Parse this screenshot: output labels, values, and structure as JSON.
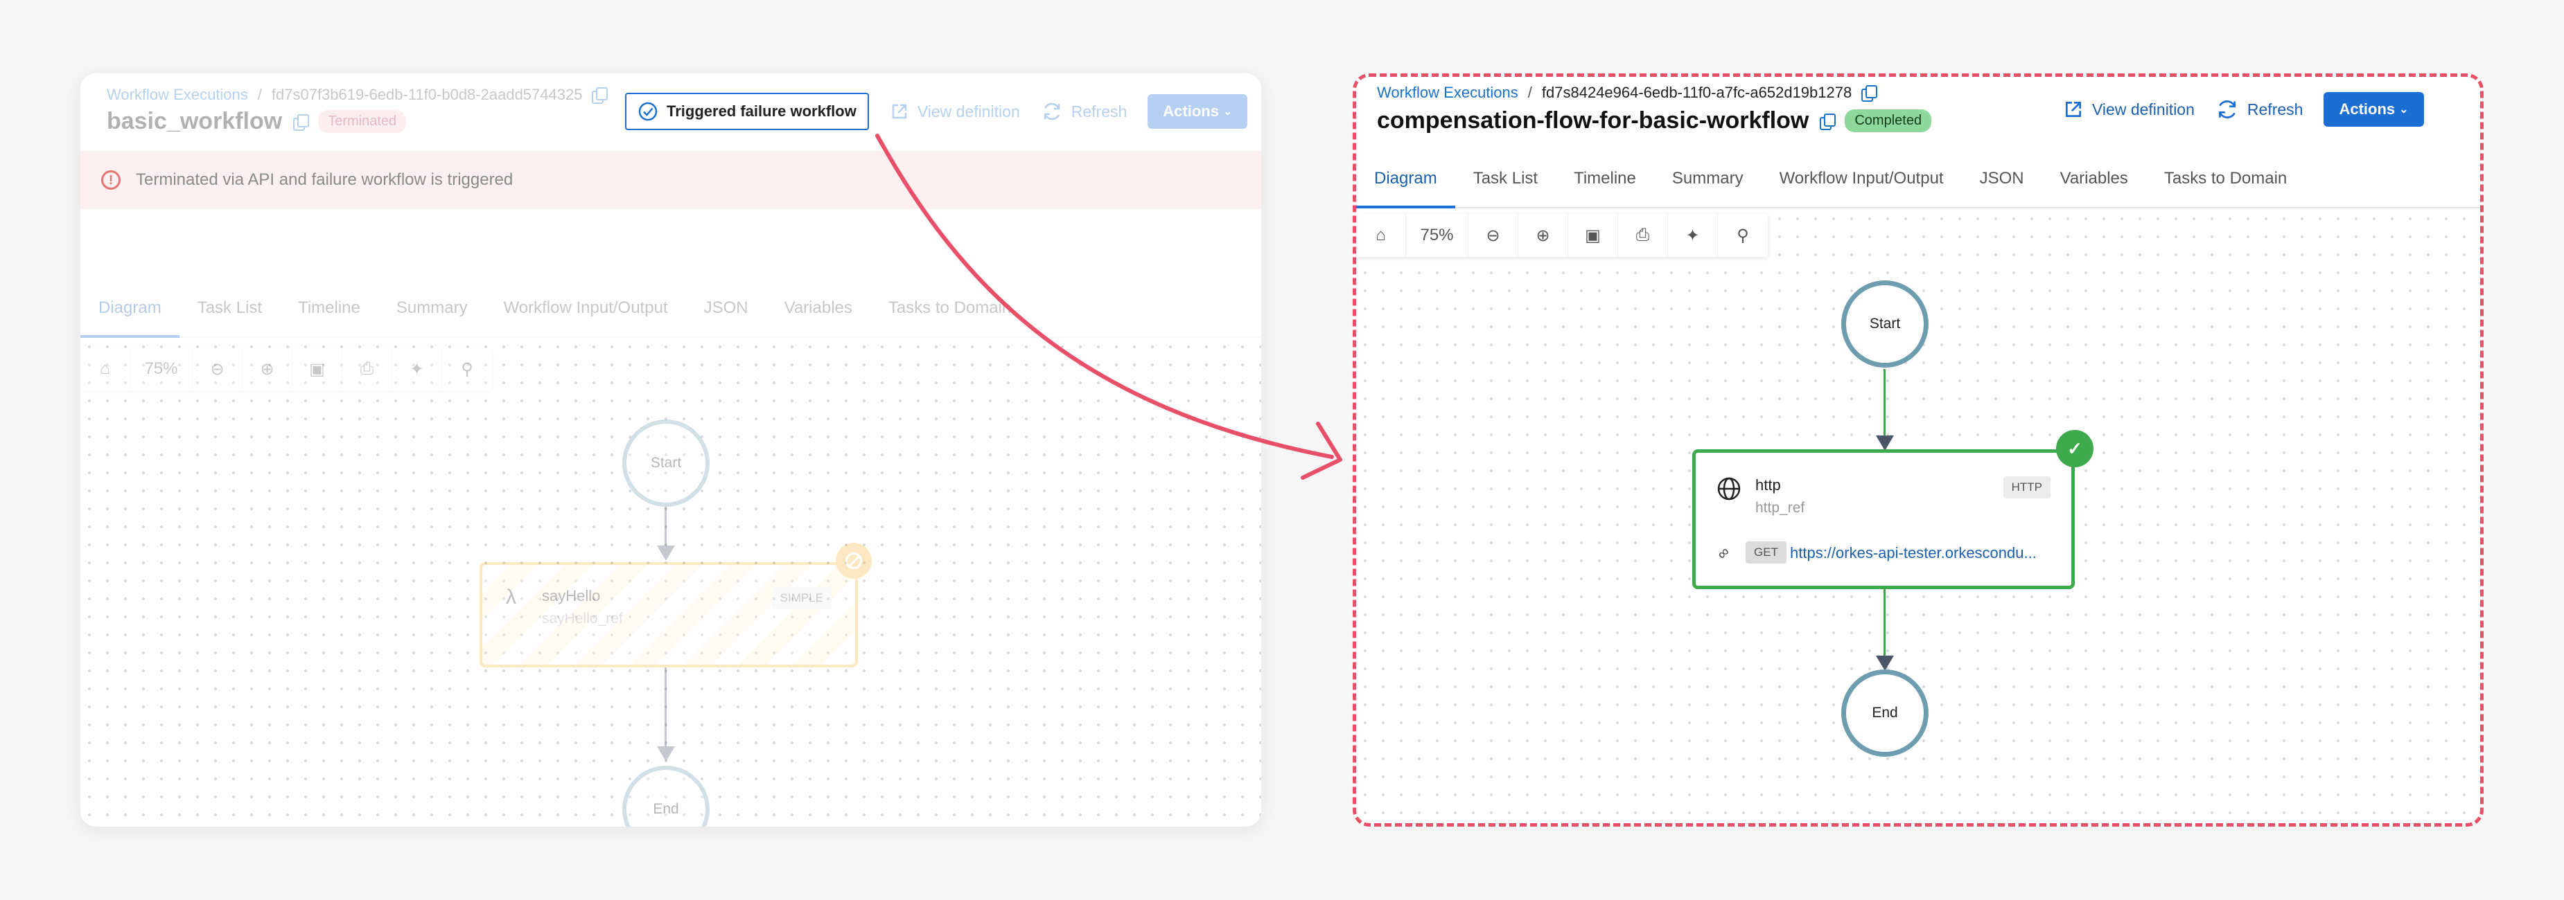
{
  "left": {
    "breadcrumb_link": "Workflow Executions",
    "breadcrumb_sep": "/",
    "execution_id": "fd7s07f3b619-6edb-11f0-b0d8-2aadd5744325",
    "title": "basic_workflow",
    "status": "Terminated",
    "triggered_button": "Triggered failure workflow",
    "view_definition": "View definition",
    "refresh": "Refresh",
    "actions": "Actions",
    "alert": "Terminated via API and failure workflow is triggered",
    "tabs": [
      "Diagram",
      "Task List",
      "Timeline",
      "Summary",
      "Workflow Input/Output",
      "JSON",
      "Variables",
      "Tasks to Domain"
    ],
    "zoom": "75%",
    "start_label": "Start",
    "end_label": "End",
    "task": {
      "name": "sayHello",
      "ref": "sayHello_ref",
      "type": "SIMPLE"
    }
  },
  "right": {
    "breadcrumb_link": "Workflow Executions",
    "breadcrumb_sep": "/",
    "execution_id": "fd7s8424e964-6edb-11f0-a7fc-a652d19b1278",
    "title": "compensation-flow-for-basic-workflow",
    "status": "Completed",
    "view_definition": "View definition",
    "refresh": "Refresh",
    "actions": "Actions",
    "tabs": [
      "Diagram",
      "Task List",
      "Timeline",
      "Summary",
      "Workflow Input/Output",
      "JSON",
      "Variables",
      "Tasks to Domain"
    ],
    "zoom": "75%",
    "start_label": "Start",
    "end_label": "End",
    "task": {
      "name": "http",
      "ref": "http_ref",
      "type": "HTTP",
      "method": "GET",
      "url": "https://orkes-api-tester.orkescondu..."
    }
  },
  "colors": {
    "accent": "#1b6fd3",
    "completed": "#8fd89b",
    "terminated": "#f8c9d0",
    "success_border": "#3daa4c",
    "callout": "#e8506a"
  }
}
